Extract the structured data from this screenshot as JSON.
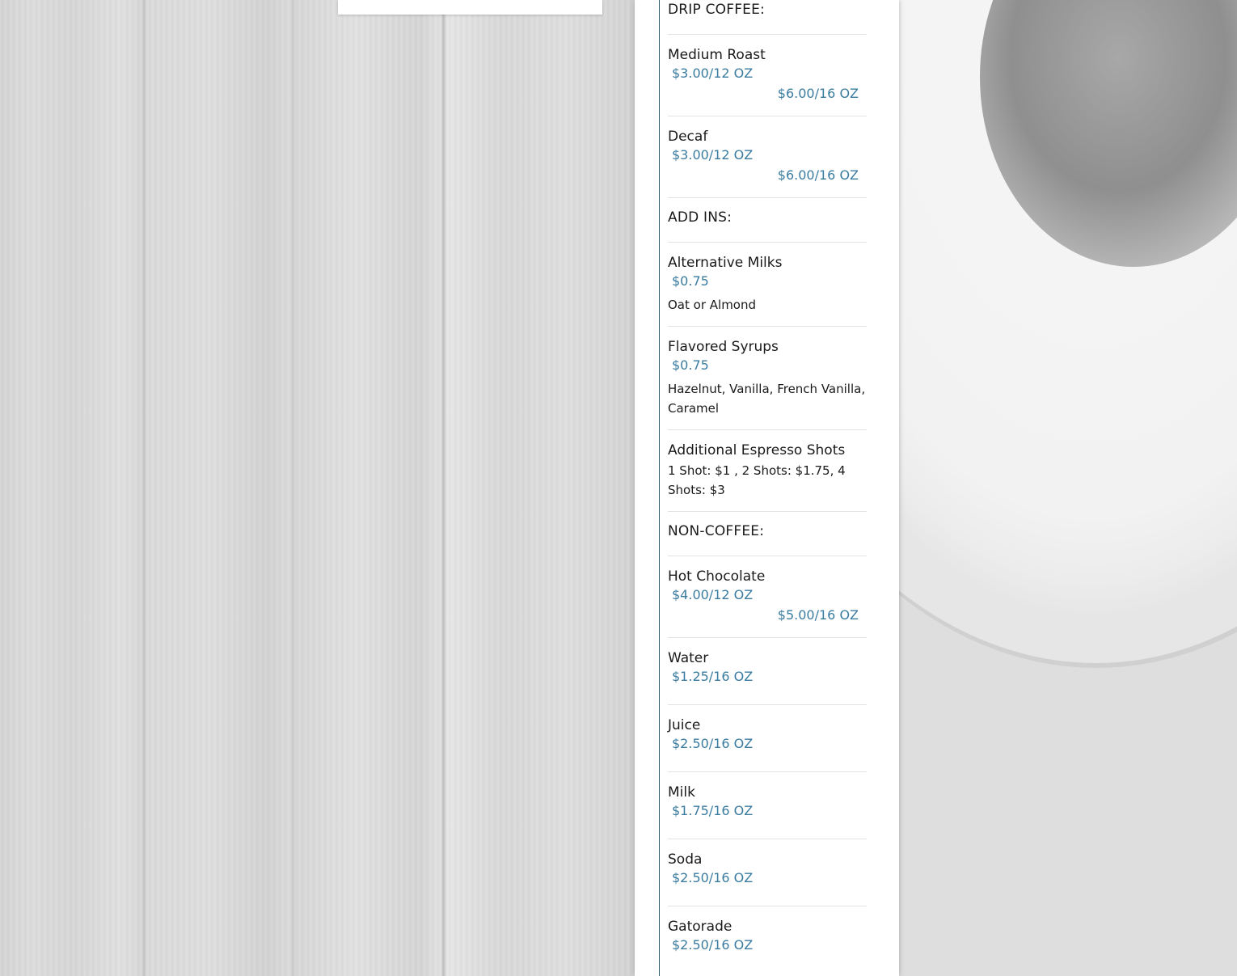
{
  "menu": {
    "sections": [
      {
        "title": "DRIP COFFEE:",
        "items": [
          {
            "name": "Medium Roast",
            "price1": "$3.00/12 OZ",
            "price2": "$6.00/16 OZ"
          },
          {
            "name": "Decaf",
            "price1": "$3.00/12 OZ",
            "price2": "$6.00/16 OZ"
          }
        ]
      },
      {
        "title": "ADD INS:",
        "items": [
          {
            "name": "Alternative Milks",
            "price1": "$0.75",
            "desc": "Oat or Almond"
          },
          {
            "name": "Flavored Syrups",
            "price1": "$0.75",
            "desc": "Hazelnut, Vanilla, French Vanilla, Caramel"
          },
          {
            "name": "Additional Espresso Shots",
            "desc": "1 Shot: $1 , 2 Shots: $1.75, 4 Shots: $3"
          }
        ]
      },
      {
        "title": "NON-COFFEE:",
        "items": [
          {
            "name": "Hot Chocolate",
            "price1": "$4.00/12 OZ",
            "price2": "$5.00/16 OZ"
          },
          {
            "name": "Water",
            "price1": "$1.25/16 OZ"
          },
          {
            "name": "Juice",
            "price1": "$2.50/16 OZ"
          },
          {
            "name": "Milk",
            "price1": "$1.75/16 OZ"
          },
          {
            "name": "Soda",
            "price1": "$2.50/16 OZ"
          },
          {
            "name": "Gatorade",
            "price1": "$2.50/16 OZ"
          }
        ]
      }
    ]
  },
  "colors": {
    "price": "#3a7ca0",
    "rule": "#2f5f6e"
  }
}
